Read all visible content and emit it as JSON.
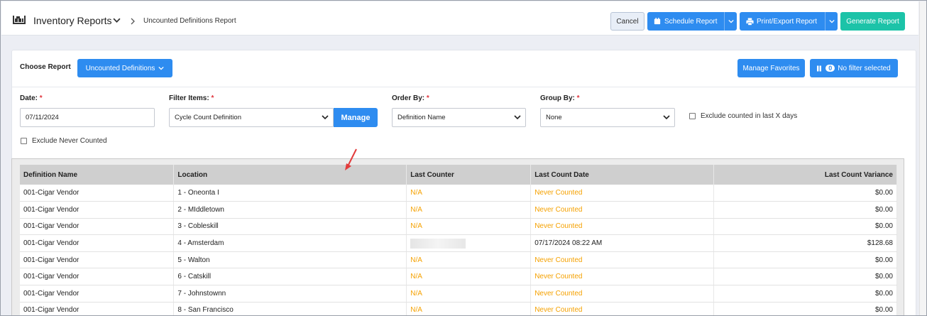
{
  "header": {
    "app_title": "Inventory Reports",
    "breadcrumb": "Uncounted Definitions Report",
    "cancel_label": "Cancel",
    "schedule_label": "Schedule Report",
    "export_label": "Print/Export Report",
    "generate_label": "Generate Report"
  },
  "report_bar": {
    "choose_label": "Choose Report",
    "selected_report": "Uncounted Definitions",
    "favorites_label": "Manage Favorites",
    "filter_count": "0",
    "filter_label": "No filter selected"
  },
  "form": {
    "date_label": "Date:",
    "date_value": "07/11/2024",
    "filter_label": "Filter Items:",
    "filter_value": "Cycle Count Definition",
    "manage_label": "Manage",
    "order_label": "Order By:",
    "order_value": "Definition Name",
    "group_label": "Group By:",
    "group_value": "None",
    "exclude_days_label": "Exclude counted in last X days",
    "exclude_never_label": "Exclude Never Counted",
    "required_mark": "*"
  },
  "table": {
    "columns": [
      "Definition Name",
      "Location",
      "Last Counter",
      "Last Count Date",
      "Last Count Variance"
    ],
    "rows": [
      {
        "definition": "001-Cigar Vendor",
        "location": "1 - Oneonta I",
        "counter": "N/A",
        "date": "Never Counted",
        "variance": "$0.00"
      },
      {
        "definition": "001-Cigar Vendor",
        "location": "2 - MIddletown",
        "counter": "N/A",
        "date": "Never Counted",
        "variance": "$0.00"
      },
      {
        "definition": "001-Cigar Vendor",
        "location": "3 - Cobleskill",
        "counter": "N/A",
        "date": "Never Counted",
        "variance": "$0.00"
      },
      {
        "definition": "001-Cigar Vendor",
        "location": "4 - Amsterdam",
        "counter": "",
        "date": "07/17/2024 08:22 AM",
        "variance": "$128.68"
      },
      {
        "definition": "001-Cigar Vendor",
        "location": "5 - Walton",
        "counter": "N/A",
        "date": "Never Counted",
        "variance": "$0.00"
      },
      {
        "definition": "001-Cigar Vendor",
        "location": "6 - Catskill",
        "counter": "N/A",
        "date": "Never Counted",
        "variance": "$0.00"
      },
      {
        "definition": "001-Cigar Vendor",
        "location": "7 - Johnstownn",
        "counter": "N/A",
        "date": "Never Counted",
        "variance": "$0.00"
      },
      {
        "definition": "001-Cigar Vendor",
        "location": "8 - San Francisco",
        "counter": "N/A",
        "date": "Never Counted",
        "variance": "$0.00"
      }
    ]
  },
  "colors": {
    "primary": "#2e8cf0",
    "generate": "#1cc3a8",
    "warning_text": "#f5a100",
    "required": "#e0343c"
  },
  "icons": [
    "inventory-icon",
    "chevron-down-icon",
    "chevron-right-icon",
    "calendar-icon",
    "printer-icon",
    "filter-icon",
    "red-arrow-annotation"
  ]
}
